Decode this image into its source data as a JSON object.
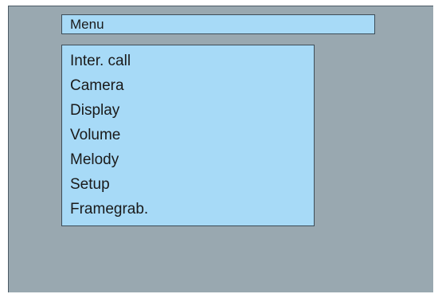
{
  "title": "Menu",
  "menu": {
    "items": [
      {
        "label": "Inter. call"
      },
      {
        "label": "Camera"
      },
      {
        "label": "Display"
      },
      {
        "label": "Volume"
      },
      {
        "label": "Melody"
      },
      {
        "label": "Setup"
      },
      {
        "label": "Framegrab."
      }
    ]
  },
  "colors": {
    "screen_background": "#99a8b0",
    "panel_background": "#a7daf7",
    "border": "#3d4d58",
    "text": "#1a1a1a"
  }
}
